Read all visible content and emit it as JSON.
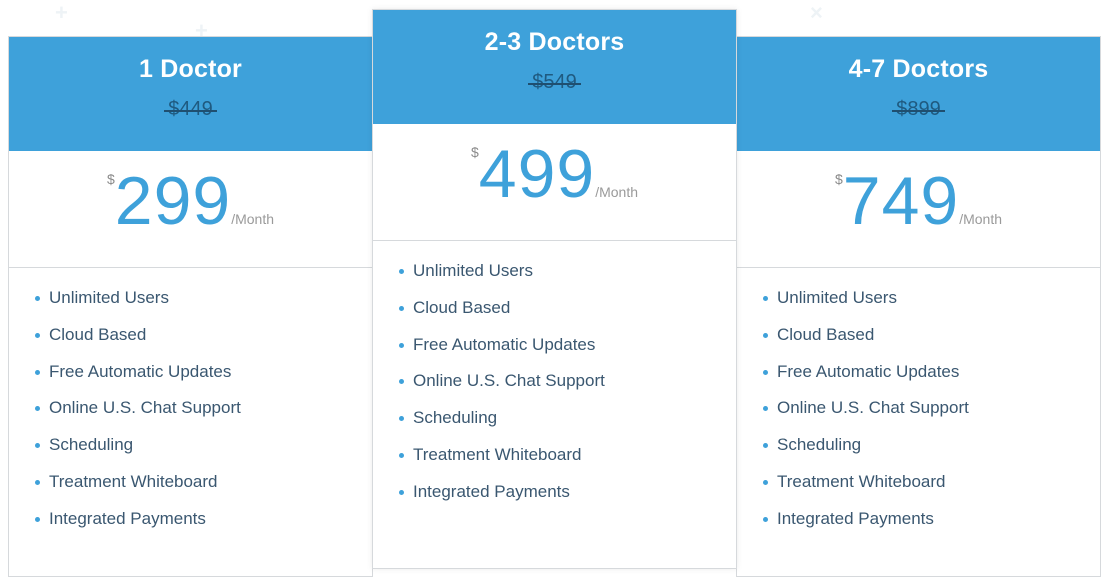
{
  "colors": {
    "accent": "#3ea1da",
    "old_price": "#1f5a80",
    "feature_text": "#3a5770",
    "period_text": "#9a9a9a"
  },
  "plans": [
    {
      "name": "1 Doctor",
      "old_price": "$449",
      "currency": "$",
      "price": "299",
      "period": "/Month",
      "features": [
        "Unlimited Users",
        "Cloud Based",
        "Free Automatic Updates",
        "Online U.S. Chat Support",
        "Scheduling",
        "Treatment Whiteboard",
        "Integrated Payments"
      ]
    },
    {
      "name": "2-3 Doctors",
      "old_price": "$549",
      "currency": "$",
      "price": "499",
      "period": "/Month",
      "featured": true,
      "features": [
        "Unlimited Users",
        "Cloud Based",
        "Free Automatic Updates",
        "Online U.S. Chat Support",
        "Scheduling",
        "Treatment Whiteboard",
        "Integrated Payments"
      ]
    },
    {
      "name": "4-7 Doctors",
      "old_price": "$899",
      "currency": "$",
      "price": "749",
      "period": "/Month",
      "features": [
        "Unlimited Users",
        "Cloud Based",
        "Free Automatic Updates",
        "Online U.S. Chat Support",
        "Scheduling",
        "Treatment Whiteboard",
        "Integrated Payments"
      ]
    }
  ]
}
